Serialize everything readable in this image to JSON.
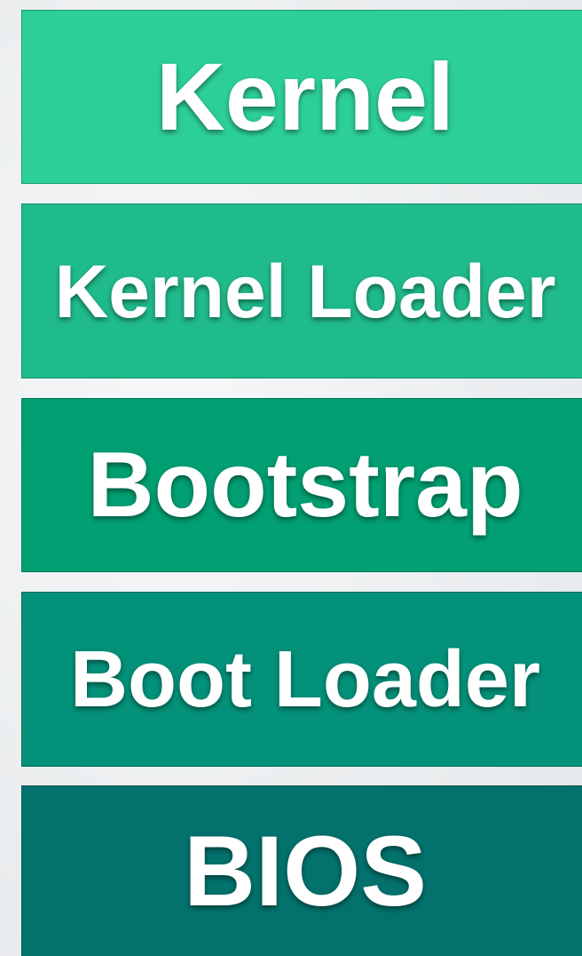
{
  "layers": [
    {
      "label": "Kernel",
      "color": "#2ccf9a"
    },
    {
      "label": "Kernel Loader",
      "color": "#20bb8c"
    },
    {
      "label": "Bootstrap",
      "color": "#019f72"
    },
    {
      "label": "Boot Loader",
      "color": "#049179"
    },
    {
      "label": "BIOS",
      "color": "#03716c"
    }
  ]
}
